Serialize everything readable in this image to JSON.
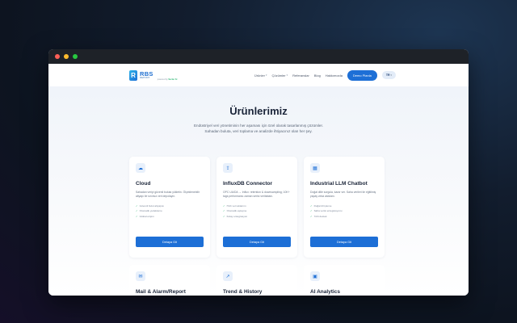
{
  "brand": {
    "mark": "R",
    "name": "RBS",
    "sub": "REPORT",
    "by_prefix": "powered by",
    "by_name": "Sectur AI"
  },
  "nav": {
    "links": [
      {
        "label": "Ürünler",
        "dropdown": true
      },
      {
        "label": "Çözümler",
        "dropdown": true
      },
      {
        "label": "Referanslar",
        "dropdown": false
      },
      {
        "label": "Blog",
        "dropdown": false
      },
      {
        "label": "Hakkımızda",
        "dropdown": false
      }
    ],
    "demo_label": "Demo Planla",
    "lang": "TR"
  },
  "hero": {
    "title": "Ürünlerimiz",
    "subtitle_line1": "Endüstriyel veri yönetiminin her aşaması için özel olarak tasarlanmış çözümler.",
    "subtitle_line2": "Sahadan buluta, veri toplama ve analizde ihtiyacınız olan her şey."
  },
  "products": [
    {
      "icon": "cloud-icon",
      "glyph": "☁",
      "title": "Cloud",
      "desc": "Sahadan veriyi güvenli buluta yükletin. Ölçeklenebilir altyapı ile sınırsız veri depolayın.",
      "features": [
        "Güvenli bulut altyapısı",
        "Otomatik yedekleme",
        "Global erişim"
      ],
      "button": "Detaya Git"
    },
    {
      "icon": "database-icon",
      "glyph": "⇪",
      "title": "InfluxDB Connector",
      "desc": "OPC UA/DA → Influx: retention & downsampling; 10K+ tags performansı zaman serisi veritabanı.",
      "features": [
        "Hızlı veri aktarımı",
        "Otomatik eşleşme",
        "Kolay entegrasyon"
      ],
      "button": "Detaya Git"
    },
    {
      "icon": "chatbot-icon",
      "glyph": "▦",
      "title": "Industrial LLM Chatbot",
      "desc": "Doğal dille sorgula, karar ver. Saha verileri ile eğitilmiş yapay zeka asistanı.",
      "features": [
        "Doğal dil işleme",
        "Saha verisi entegrasyonu",
        "7/24 destek"
      ],
      "button": "Detaya Git"
    }
  ],
  "products_row2": [
    {
      "icon": "mail-icon",
      "glyph": "✉",
      "title": "Mail & Alarm/Report"
    },
    {
      "icon": "trend-icon",
      "glyph": "↗",
      "title": "Trend & History"
    },
    {
      "icon": "analytics-icon",
      "glyph": "▣",
      "title": "AI Analytics"
    }
  ],
  "colors": {
    "accent": "#1d6fd6",
    "check": "#2bb673",
    "heading": "#1a2438"
  }
}
